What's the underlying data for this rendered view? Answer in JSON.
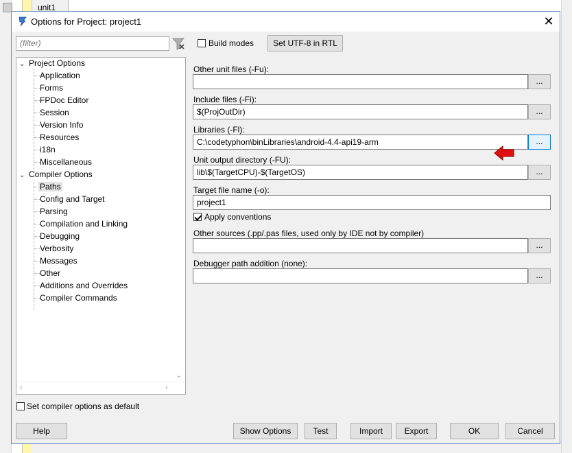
{
  "background": {
    "tab_label": "unit1"
  },
  "dialog": {
    "title": "Options for Project: project1",
    "close_glyph": "✕"
  },
  "filter": {
    "placeholder": "(filter)"
  },
  "tree": {
    "groups": [
      {
        "label": "Project Options",
        "children": [
          "Application",
          "Forms",
          "FPDoc Editor",
          "Session",
          "Version Info",
          "Resources",
          "i18n",
          "Miscellaneous"
        ]
      },
      {
        "label": "Compiler Options",
        "children": [
          "Paths",
          "Config and Target",
          "Parsing",
          "Compilation and Linking",
          "Debugging",
          "Verbosity",
          "Messages",
          "Other",
          "Additions and Overrides",
          "Compiler Commands"
        ]
      }
    ],
    "selected": "Paths"
  },
  "toolbar": {
    "build_modes_label": "Build modes",
    "build_modes_checked": false,
    "utf8_button": "Set UTF-8 in RTL"
  },
  "paths": {
    "other_unit_files": {
      "label": "Other unit files (-Fu):",
      "value": ""
    },
    "include_files": {
      "label": "Include files (-Fi):",
      "value": "$(ProjOutDir)"
    },
    "libraries": {
      "label": "Libraries (-Fl):",
      "value": "C:\\codetyphon\\binLibraries\\android-4.4-api19-arm"
    },
    "unit_output": {
      "label": "Unit output directory (-FU):",
      "value": "lib\\$(TargetCPU)-$(TargetOS)"
    },
    "target_file": {
      "label": "Target file name (-o):",
      "value": "project1"
    },
    "apply_conventions": {
      "label": "Apply conventions",
      "checked": true
    },
    "other_sources": {
      "label": "Other sources (.pp/.pas files, used only by IDE not by compiler)",
      "value": ""
    },
    "debugger_path": {
      "label": "Debugger path addition (none):",
      "value": ""
    },
    "browse_label": "..."
  },
  "defaults": {
    "label": "Set compiler options as default",
    "checked": false
  },
  "buttons": {
    "help": "Help",
    "show_options": "Show Options",
    "test": "Test",
    "import": "Import",
    "export": "Export",
    "ok": "OK",
    "cancel": "Cancel"
  },
  "colors": {
    "arrow": "#e01010",
    "focus": "#0078d7",
    "dialog_bg": "#f0f0f0"
  },
  "icons": {
    "title": "lazarus-app-icon",
    "filter_clear": "clear-filter-icon",
    "arrow": "red-arrow-icon"
  }
}
